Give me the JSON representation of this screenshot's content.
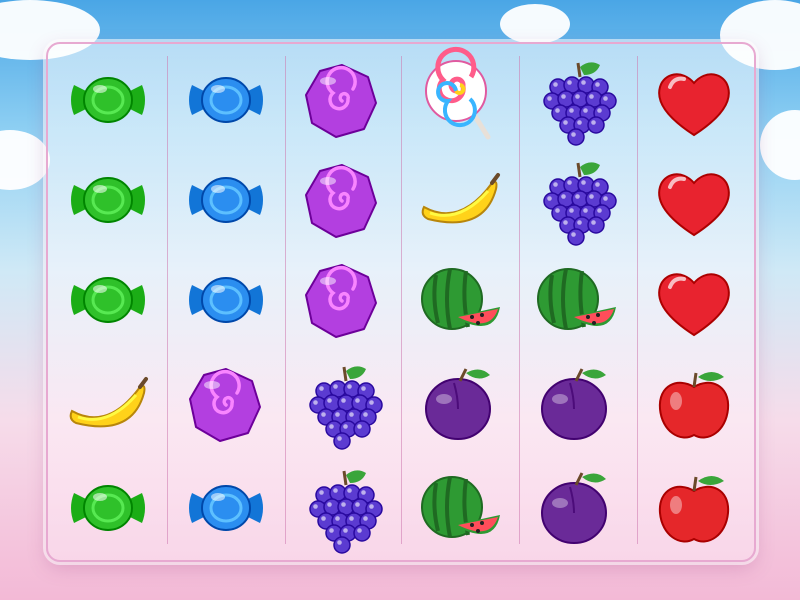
{
  "game": {
    "grid": {
      "columns": 6,
      "rows": 5,
      "symbols": [
        [
          "green-candy",
          "blue-candy",
          "purple-swirl",
          "lollipop",
          "grapes",
          "heart"
        ],
        [
          "green-candy",
          "blue-candy",
          "purple-swirl",
          "banana",
          "grapes",
          "heart"
        ],
        [
          "green-candy",
          "blue-candy",
          "purple-swirl",
          "watermelon",
          "watermelon",
          "heart"
        ],
        [
          "banana",
          "purple-swirl",
          "grapes",
          "plum",
          "plum",
          "apple"
        ],
        [
          "green-candy",
          "blue-candy",
          "grapes",
          "watermelon",
          "plum",
          "apple"
        ]
      ]
    },
    "colors": {
      "green-candy": "#2fc12a",
      "blue-candy": "#2b8ef0",
      "purple-swirl": "#b33fe0",
      "lollipop": "#ff5c8a",
      "grapes": "#5b3bd1",
      "heart": "#e8232f",
      "banana": "#ffd21a",
      "watermelon": "#2e9a33",
      "plum": "#6a2a98",
      "apple": "#e5272a",
      "board_border": "#e7a9d1"
    }
  }
}
